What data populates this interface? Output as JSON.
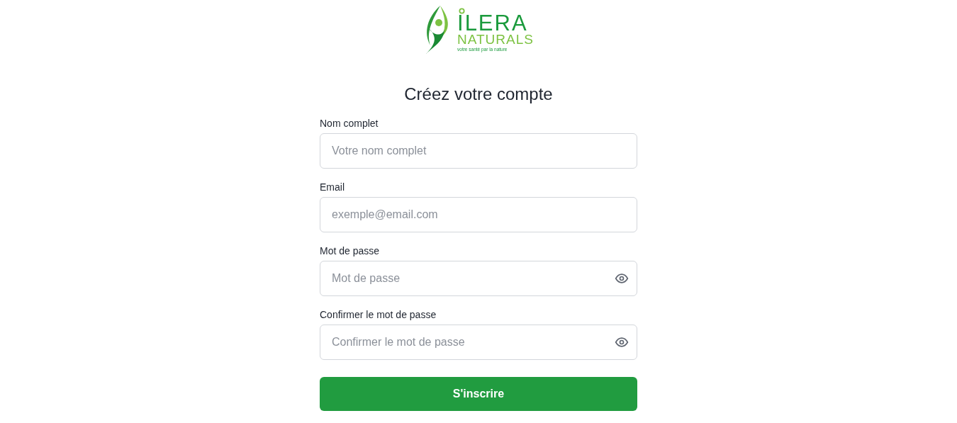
{
  "logo": {
    "name": "ILERA",
    "subtitle": "NATURALS",
    "tagline": "votre santé par la nature"
  },
  "title": "Créez votre compte",
  "fields": [
    {
      "label": "Nom complet",
      "placeholder": "Votre nom complet",
      "kind": "text"
    },
    {
      "label": "Email",
      "placeholder": "exemple@email.com",
      "kind": "text"
    },
    {
      "label": "Mot de passe",
      "placeholder": "Mot de passe",
      "kind": "password"
    },
    {
      "label": "Confirmer le mot de passe",
      "placeholder": "Confirmer le mot de passe",
      "kind": "password"
    }
  ],
  "submit": "S'inscrire"
}
